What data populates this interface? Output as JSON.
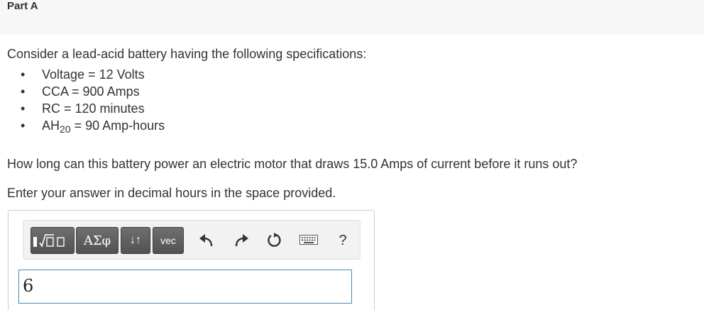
{
  "part": {
    "title": "Part A"
  },
  "problem": {
    "intro": "Consider a lead-acid battery having the following specifications:",
    "bullet": "•",
    "specs": [
      {
        "text": "Voltage = 12 Volts"
      },
      {
        "text": "CCA = 900 Amps"
      },
      {
        "text": "RC = 120 minutes"
      },
      {
        "prefix": "AH",
        "sub": "20",
        "suffix": " = 90 Amp-hours"
      }
    ],
    "question": "How long can this battery power an electric motor that draws 15.0 Amps of current before it runs out?",
    "instruction": "Enter your answer in decimal hours in the space provided."
  },
  "toolbar": {
    "greek_label": "ΑΣφ",
    "arrows_label": "↓↑",
    "vec_label": "vec",
    "help_label": "?",
    "icons": [
      "templates-icon",
      "greek-icon",
      "subsup-icon",
      "vec-icon",
      "undo-icon",
      "redo-icon",
      "reset-icon",
      "keyboard-icon",
      "help-icon"
    ]
  },
  "answer": {
    "value": "6"
  },
  "colors": {
    "header_bg": "#f7f7f7",
    "button_bg": "#5f5f5f",
    "input_border": "#4a8ab0",
    "text": "#333333"
  }
}
